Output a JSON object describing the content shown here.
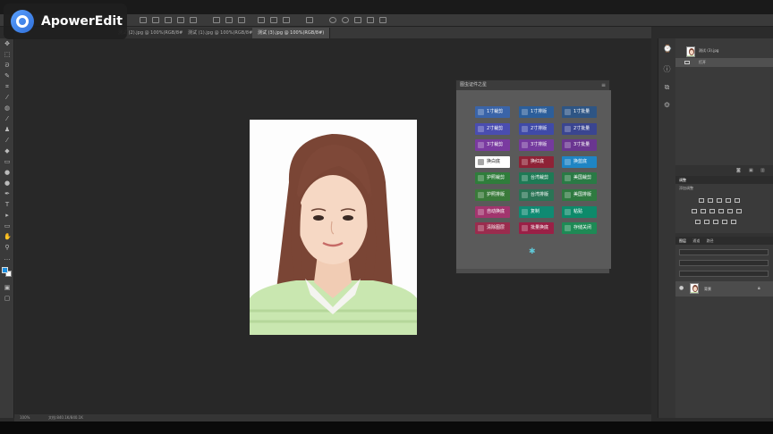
{
  "watermark": {
    "brand": "ApowerEdit"
  },
  "tabs": [
    {
      "label": "测试 (2).jpg @ 100%(RGB/8#)",
      "active": false
    },
    {
      "label": "测试 (1).jpg @ 100%(RGB/8#)",
      "active": false
    },
    {
      "label": "测试 (3).jpg @ 100%(RGB/8#)",
      "active": true
    }
  ],
  "plugin": {
    "title": "图虫证件之星",
    "menu_glyph": "≡",
    "buttons": [
      {
        "label": "1寸裁剪",
        "color": "#3a64a8"
      },
      {
        "label": "1寸排版",
        "color": "#2c5e9a"
      },
      {
        "label": "1寸批量",
        "color": "#2e5584"
      },
      {
        "label": "2寸裁剪",
        "color": "#4a4db0"
      },
      {
        "label": "2寸排版",
        "color": "#3f4aa8"
      },
      {
        "label": "2寸批量",
        "color": "#3a4590"
      },
      {
        "label": "3寸裁剪",
        "color": "#7a3aa0"
      },
      {
        "label": "3寸排版",
        "color": "#743a9e"
      },
      {
        "label": "3寸批量",
        "color": "#6a3590"
      },
      {
        "label": "换白底",
        "color": "#ffffff",
        "text_color": "#222222"
      },
      {
        "label": "换红底",
        "color": "#8e2236"
      },
      {
        "label": "换蓝底",
        "color": "#1f85c4"
      },
      {
        "label": "护照裁剪",
        "color": "#2f7d3b"
      },
      {
        "label": "台湾裁剪",
        "color": "#1e7a55"
      },
      {
        "label": "美国裁剪",
        "color": "#2a7a45"
      },
      {
        "label": "护照排版",
        "color": "#3a7a3a"
      },
      {
        "label": "台湾排版",
        "color": "#2a7455"
      },
      {
        "label": "美国排版",
        "color": "#2f7a40"
      },
      {
        "label": "自动换底",
        "color": "#a2356e"
      },
      {
        "label": "复制",
        "color": "#0f8a72"
      },
      {
        "label": "粘贴",
        "color": "#0d8a6a"
      },
      {
        "label": "清除图层",
        "color": "#9a2c4e"
      },
      {
        "label": "批量换底",
        "color": "#9a2046"
      },
      {
        "label": "存储关闭",
        "color": "#1e8a55"
      }
    ],
    "footer_icon": "bluetooth-icon"
  },
  "history_panel": {
    "file": "测试 (3).jpg",
    "step": "打开"
  },
  "adjust_panel": {
    "tab": "调整",
    "hint": "添加调整"
  },
  "layers_panel": {
    "tabs": [
      "图层",
      "通道",
      "路径"
    ],
    "layer_name": "背景"
  },
  "status": {
    "zoom": "100%",
    "doc": "文档:840.1K/840.1K"
  },
  "colors": {
    "foreground": "#1d8fe0",
    "background": "#ffffff"
  }
}
